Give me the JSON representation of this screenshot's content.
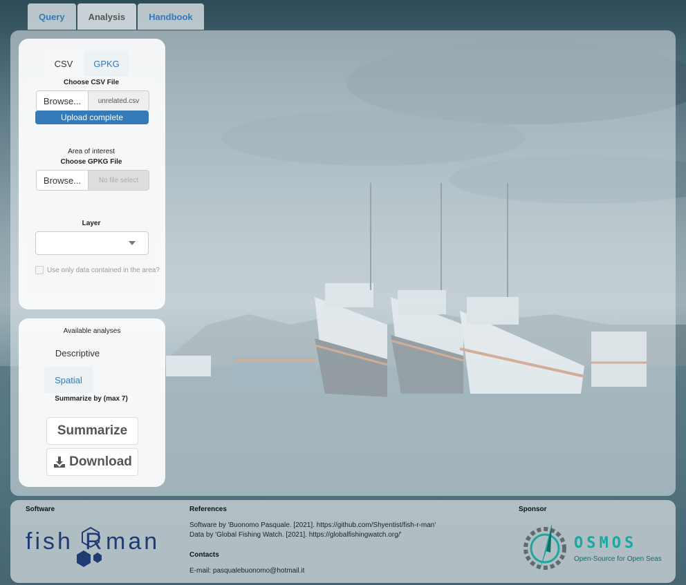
{
  "nav": {
    "tabs": [
      {
        "label": "Query",
        "active": false
      },
      {
        "label": "Analysis",
        "active": true
      },
      {
        "label": "Handbook",
        "active": false
      }
    ]
  },
  "input_panel": {
    "tabs": [
      {
        "label": "CSV",
        "active": true
      },
      {
        "label": "GPKG",
        "active": false
      }
    ],
    "csv": {
      "label": "Choose CSV File",
      "browse_label": "Browse...",
      "filename": "unrelated.csv",
      "progress_text": "Upload complete",
      "progress": 1.0
    },
    "gpkg": {
      "section_title": "Area of interest",
      "label": "Choose GPKG File",
      "browse_label": "Browse...",
      "filename": "No file select",
      "layer_label": "Layer",
      "layer_value": "",
      "checkbox_label": "Use only data contained in the area?",
      "checkbox_checked": false
    }
  },
  "analysis_panel": {
    "title": "Available analyses",
    "tabs": [
      {
        "label": "Descriptive",
        "active": true
      },
      {
        "label": "Spatial",
        "active": false
      }
    ],
    "summarize_by_label": "Summarize by (max 7)",
    "summarize_button": "Summarize",
    "download_button": "Download",
    "download_icon": "download-icon"
  },
  "footer": {
    "software": {
      "heading": "Software",
      "logo_text_left": "fish",
      "logo_text_r": "R",
      "logo_text_right": "man"
    },
    "references": {
      "heading": "References",
      "lines": [
        "Software by 'Buonomo Pasquale. [2021]. https://github.com/Shyentist/fish-r-man'",
        "Data by 'Global Fishing Watch. [2021]. https://globalfishingwatch.org/'"
      ]
    },
    "contacts": {
      "heading": "Contacts",
      "email": "E-mail: pasqualebuonomo@hotmail.it"
    },
    "sponsor": {
      "heading": "Sponsor",
      "logo_title": "OSMOS",
      "logo_subtitle": "Open-Source for Open Seas"
    }
  },
  "colors": {
    "accent": "#337ab7",
    "osmos_teal": "#1aa7a0",
    "fishrman_navy": "#1f3b73"
  }
}
